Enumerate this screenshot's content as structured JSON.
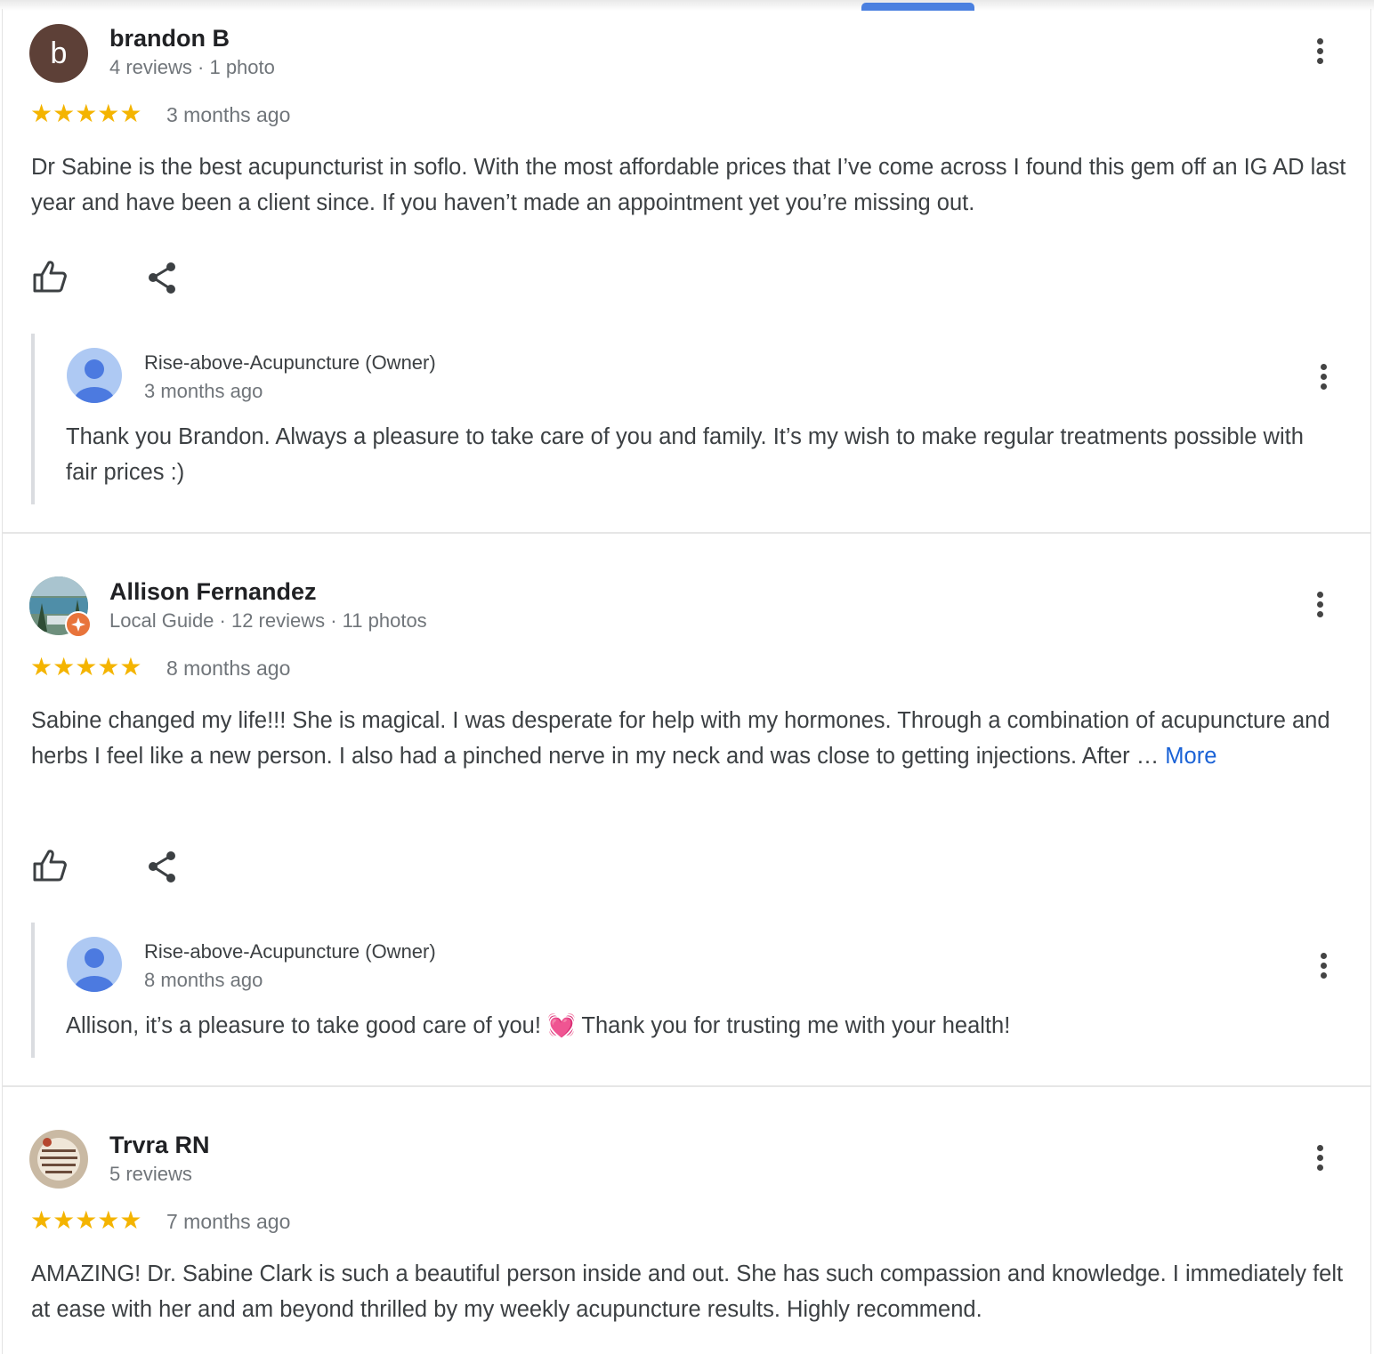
{
  "reviews": [
    {
      "author": "brandon B",
      "avatar_letter": "b",
      "meta": "4 reviews · 1 photo",
      "stars": "★★★★★",
      "rating": 5,
      "time": "3 months ago",
      "text": "Dr Sabine is the best acupuncturist in soflo. With the most affordable prices that I’ve come across I found this gem off an IG AD last year and have been a client since. If you haven’t made an appointment yet you’re missing out.",
      "reply": {
        "owner": "Rise-above-Acupuncture (Owner)",
        "time": "3 months ago",
        "text": "Thank you Brandon. Always a pleasure to take care of you and family. It’s my wish to make regular treatments possible with fair prices :)"
      }
    },
    {
      "author": "Allison Fernandez",
      "meta": "Local Guide · 12 reviews · 11 photos",
      "stars": "★★★★★",
      "rating": 5,
      "time": "8 months ago",
      "text": "Sabine changed my life!!! She is magical. I was desperate for help with my hormones. Through a combination of acupuncture and herbs I feel like a new person. I also had a pinched nerve in my neck and was close to getting injections. After … ",
      "more": "More",
      "reply": {
        "owner": "Rise-above-Acupuncture (Owner)",
        "time": "8 months ago",
        "text": "Allison, it’s a pleasure to take good care of you! 💓 Thank you for trusting me with your health!"
      }
    },
    {
      "author": "Trvra RN",
      "meta": "5 reviews",
      "stars": "★★★★★",
      "rating": 5,
      "time": "7 months ago",
      "text": "AMAZING! Dr. Sabine Clark is such a beautiful person inside and out. She has such compassion and knowledge. I immediately felt at ease with her and am beyond thrilled by my weekly acupuncture results. Highly recommend."
    }
  ],
  "icons": {
    "like": "thumbs-up-icon",
    "share": "share-icon",
    "menu": "more-vert-icon",
    "local_guide": "local-guide-badge-icon"
  },
  "colors": {
    "star": "#f4b400",
    "link": "#1a62d6",
    "meta_text": "#70757a",
    "reply_border": "#dadce0",
    "letter_avatar": "#5d4037",
    "owner_avatar": "#aec9f3"
  }
}
